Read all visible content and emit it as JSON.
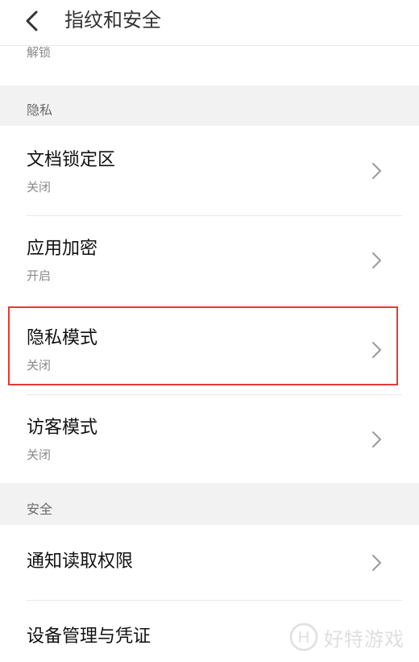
{
  "header": {
    "title": "指纹和安全"
  },
  "partial_item": {
    "label": "解锁"
  },
  "sections": {
    "privacy": {
      "label": "隐私",
      "items": [
        {
          "title": "文档锁定区",
          "status": "关闭"
        },
        {
          "title": "应用加密",
          "status": "开启"
        },
        {
          "title": "隐私模式",
          "status": "关闭"
        },
        {
          "title": "访客模式",
          "status": "关闭"
        }
      ]
    },
    "security": {
      "label": "安全",
      "items": [
        {
          "title": "通知读取权限"
        },
        {
          "title": "设备管理与凭证"
        }
      ]
    }
  },
  "watermark": {
    "letter": "H",
    "text": "好特游戏"
  },
  "colors": {
    "highlight": "#e53935",
    "section_bg": "#f2f2f2",
    "secondary_text": "#8a8a8a"
  }
}
